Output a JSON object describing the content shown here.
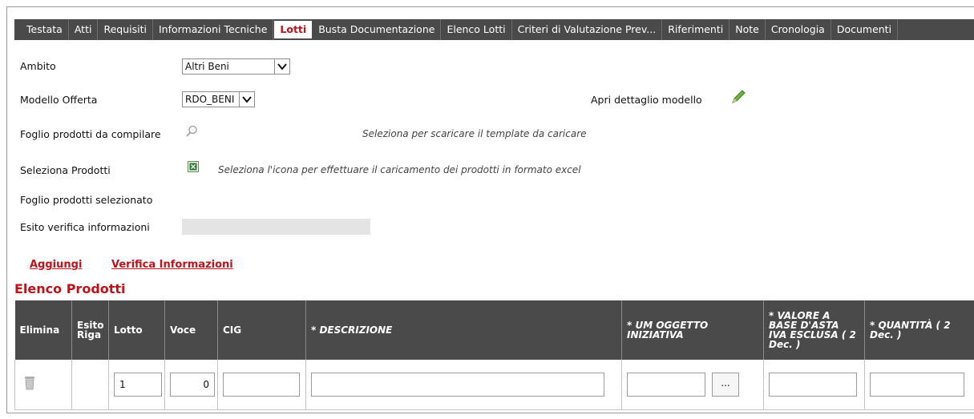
{
  "tabs": [
    {
      "label": "Testata"
    },
    {
      "label": "Atti"
    },
    {
      "label": "Requisiti"
    },
    {
      "label": "Informazioni Tecniche"
    },
    {
      "label": "Lotti",
      "active": true
    },
    {
      "label": "Busta Documentazione"
    },
    {
      "label": "Elenco Lotti"
    },
    {
      "label": "Criteri di Valutazione Prev..."
    },
    {
      "label": "Riferimenti"
    },
    {
      "label": "Note"
    },
    {
      "label": "Cronologia"
    },
    {
      "label": "Documenti"
    }
  ],
  "form": {
    "ambito_label": "Ambito",
    "ambito_value": "Altri Beni",
    "modello_label": "Modello Offerta",
    "modello_value": "RDO_BENI",
    "apri_dettaglio": "Apri dettaglio modello",
    "foglio_label": "Foglio prodotti da compilare",
    "foglio_hint": "Seleziona per scaricare il template da caricare",
    "seleziona_label": "Seleziona Prodotti",
    "seleziona_hint": "Seleziona l'icona per effettuare il caricamento dei prodotti in formato excel",
    "foglio_sel_label": "Foglio prodotti selezionato",
    "esito_label": "Esito verifica informazioni"
  },
  "actions": {
    "aggiungi": "Aggiungi",
    "verifica": "Verifica Informazioni"
  },
  "section_title": "Elenco Prodotti",
  "table": {
    "headers": {
      "elimina": "Elimina",
      "esito_riga": "Esito Riga",
      "lotto": "Lotto",
      "voce": "Voce",
      "cig": "CIG",
      "descrizione": "* DESCRIZIONE",
      "um": "* UM OGGETTO INIZIATIVA",
      "valore": "* VALORE A BASE D'ASTA IVA ESCLUSA ( 2 Dec. )",
      "quantita": "* QUANTITÀ ( 2 Dec. )"
    },
    "rows": [
      {
        "lotto": "1",
        "voce": "0",
        "cig": "",
        "descrizione": "",
        "um": "",
        "um_button": "...",
        "valore": "",
        "quantita": ""
      }
    ]
  },
  "colors": {
    "accent": "#c0121a",
    "header_bg": "#4a4a4a"
  }
}
